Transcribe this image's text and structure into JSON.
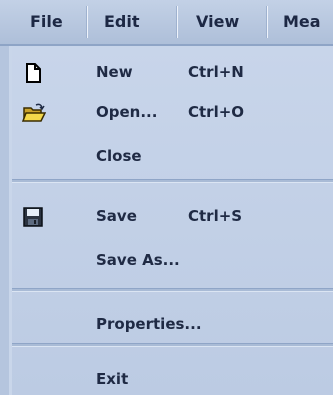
{
  "menubar": {
    "items": [
      "File",
      "Edit",
      "View",
      "Mea"
    ]
  },
  "file_menu": {
    "items": [
      {
        "label": "New",
        "shortcut": "Ctrl+N",
        "icon": "new-document-icon"
      },
      {
        "label": "Open...",
        "shortcut": "Ctrl+O",
        "icon": "open-folder-icon"
      },
      {
        "label": "Close",
        "shortcut": ""
      },
      {
        "label": "Save",
        "shortcut": "Ctrl+S",
        "icon": "save-disk-icon"
      },
      {
        "label": "Save As...",
        "shortcut": ""
      },
      {
        "label": "Properties...",
        "shortcut": ""
      },
      {
        "label": "Exit",
        "shortcut": ""
      }
    ]
  },
  "colors": {
    "menu_background": "#c3d1e7",
    "menubar_background": "#b9c9e1",
    "text": "#1f2a44"
  }
}
